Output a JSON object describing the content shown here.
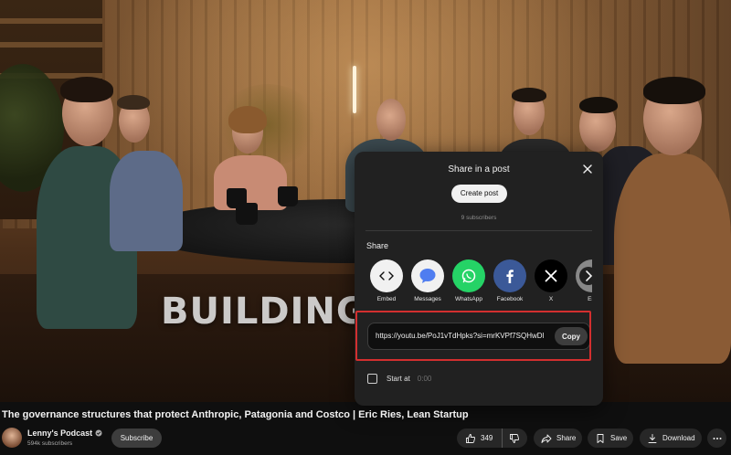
{
  "video": {
    "overlay_text": "BUILDING A"
  },
  "share_dialog": {
    "title": "Share in a post",
    "create_post_label": "Create post",
    "subscribers_text": "9 subscribers",
    "share_heading": "Share",
    "options": [
      {
        "label": "Embed",
        "icon": "embed-icon",
        "color": "#f1f1f1"
      },
      {
        "label": "Messages",
        "icon": "messages-icon",
        "color": "#f1f1f1"
      },
      {
        "label": "WhatsApp",
        "icon": "whatsapp-icon",
        "color": "#25d366"
      },
      {
        "label": "Facebook",
        "icon": "facebook-icon",
        "color": "#1877f2"
      },
      {
        "label": "X",
        "icon": "x-icon",
        "color": "#000000"
      },
      {
        "label": "Em",
        "icon": "email-icon",
        "color": "#888888"
      }
    ],
    "url_value": "https://youtu.be/PoJ1vTdHpks?si=mrKVPf7SQHwDl",
    "copy_label": "Copy",
    "start_at_label": "Start at",
    "start_at_time": "0:00"
  },
  "video_info": {
    "title": "The governance structures that protect Anthropic, Patagonia and Costco | Eric Ries, Lean Startup",
    "channel_name": "Lenny's Podcast",
    "channel_subs": "594k subscribers",
    "subscribe_label": "Subscribe",
    "like_count": "349",
    "share_label": "Share",
    "save_label": "Save",
    "download_label": "Download"
  },
  "colors": {
    "highlight": "#d32f2f",
    "dialog_bg": "#212121"
  }
}
